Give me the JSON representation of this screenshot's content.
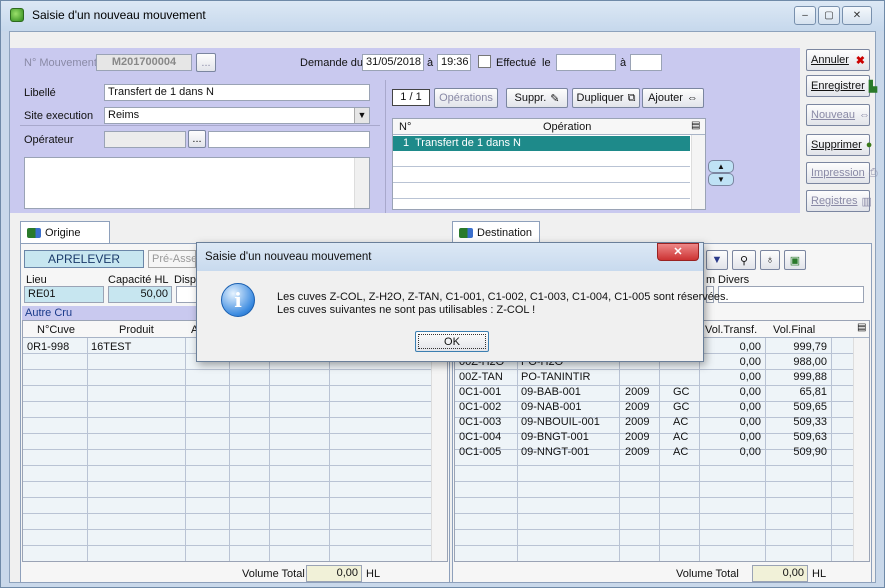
{
  "window": {
    "title": "Saisie d'un nouveau mouvement",
    "min": "–",
    "max": "▢",
    "close": "✕"
  },
  "header": {
    "num_label": "N° Mouvement",
    "num_value": "M201700004",
    "num_btn": "...",
    "demande_label": "Demande du",
    "date": "31/05/2018",
    "a1": "à",
    "time": "19:36",
    "effectue_label": "Effectué",
    "le": "le",
    "a2": "à"
  },
  "form": {
    "libelle_label": "Libellé",
    "libelle_value": "Transfert de 1 dans N",
    "site_label": "Site execution",
    "site_value": "Reims",
    "operateur_label": "Opérateur",
    "operateur_btn": "..."
  },
  "ops": {
    "pager": "1 / 1",
    "operations": "Opérations",
    "suppr": "Suppr.",
    "dupliquer": "Dupliquer",
    "ajouter": "Ajouter",
    "col_num": "N°",
    "col_op": "Opération",
    "rows": [
      {
        "num": "1",
        "op": "Transfert de 1 dans N"
      }
    ]
  },
  "side": {
    "annuler": "Annuler",
    "enregistrer": "Enregistrer",
    "nouveau": "Nouveau",
    "supprimer": "Supprimer",
    "impression": "Impression",
    "registres": "Registres"
  },
  "origine": {
    "tab": "Origine",
    "aprelever": "APRELEVER",
    "pre_assem": "Pré-Assem",
    "lieu_label": "Lieu",
    "lieu_value": "RE01",
    "cap_label": "Capacité HL",
    "cap_value": "50,00",
    "dispo_label": "Dispo",
    "group": "Autre Cru",
    "col_cuve": "N°Cuve",
    "col_produit": "Produit",
    "col_a": "A",
    "rows": [
      {
        "cuve": "0R1-998",
        "produit": "16TEST"
      }
    ],
    "vol_label": "Volume Total",
    "vol_value": "0,00",
    "unit": "HL"
  },
  "destination": {
    "tab": "Destination",
    "divers_label": "Divers",
    "m_label": "m",
    "col_transf": "Vol.Transf.",
    "col_final": "Vol.Final",
    "rows": [
      {
        "cuve": "",
        "produit": "",
        "annee": "",
        "cat": "",
        "transf": "0,00",
        "final": "999,79"
      },
      {
        "cuve": "00Z-H2O",
        "produit": "PO-H2O",
        "annee": "",
        "cat": "",
        "transf": "0,00",
        "final": "988,00"
      },
      {
        "cuve": "00Z-TAN",
        "produit": "PO-TANINTIR",
        "annee": "",
        "cat": "",
        "transf": "0,00",
        "final": "999,88"
      },
      {
        "cuve": "0C1-001",
        "produit": "09-BAB-001",
        "annee": "2009",
        "cat": "GC",
        "transf": "0,00",
        "final": "65,81"
      },
      {
        "cuve": "0C1-002",
        "produit": "09-NAB-001",
        "annee": "2009",
        "cat": "GC",
        "transf": "0,00",
        "final": "509,65"
      },
      {
        "cuve": "0C1-003",
        "produit": "09-NBOUIL-001",
        "annee": "2009",
        "cat": "AC",
        "transf": "0,00",
        "final": "509,33"
      },
      {
        "cuve": "0C1-004",
        "produit": "09-BNGT-001",
        "annee": "2009",
        "cat": "AC",
        "transf": "0,00",
        "final": "509,63"
      },
      {
        "cuve": "0C1-005",
        "produit": "09-NNGT-001",
        "annee": "2009",
        "cat": "AC",
        "transf": "0,00",
        "final": "509,90"
      }
    ],
    "vol_label": "Volume Total",
    "vol_value": "0,00",
    "unit": "HL"
  },
  "dialog": {
    "title": "Saisie d'un nouveau mouvement",
    "line1": "Les cuves Z-COL, Z-H2O, Z-TAN, C1-001, C1-002, C1-003, C1-004, C1-005 sont réservées.",
    "line2": "Les cuves suivantes ne sont pas utilisables : Z-COL !",
    "ok": "OK",
    "close": "✕",
    "info_glyph": "i"
  },
  "colors": {
    "panel": "#c9c9ef",
    "selection": "#1e8a8a",
    "highlight": "#c7e6f0"
  }
}
